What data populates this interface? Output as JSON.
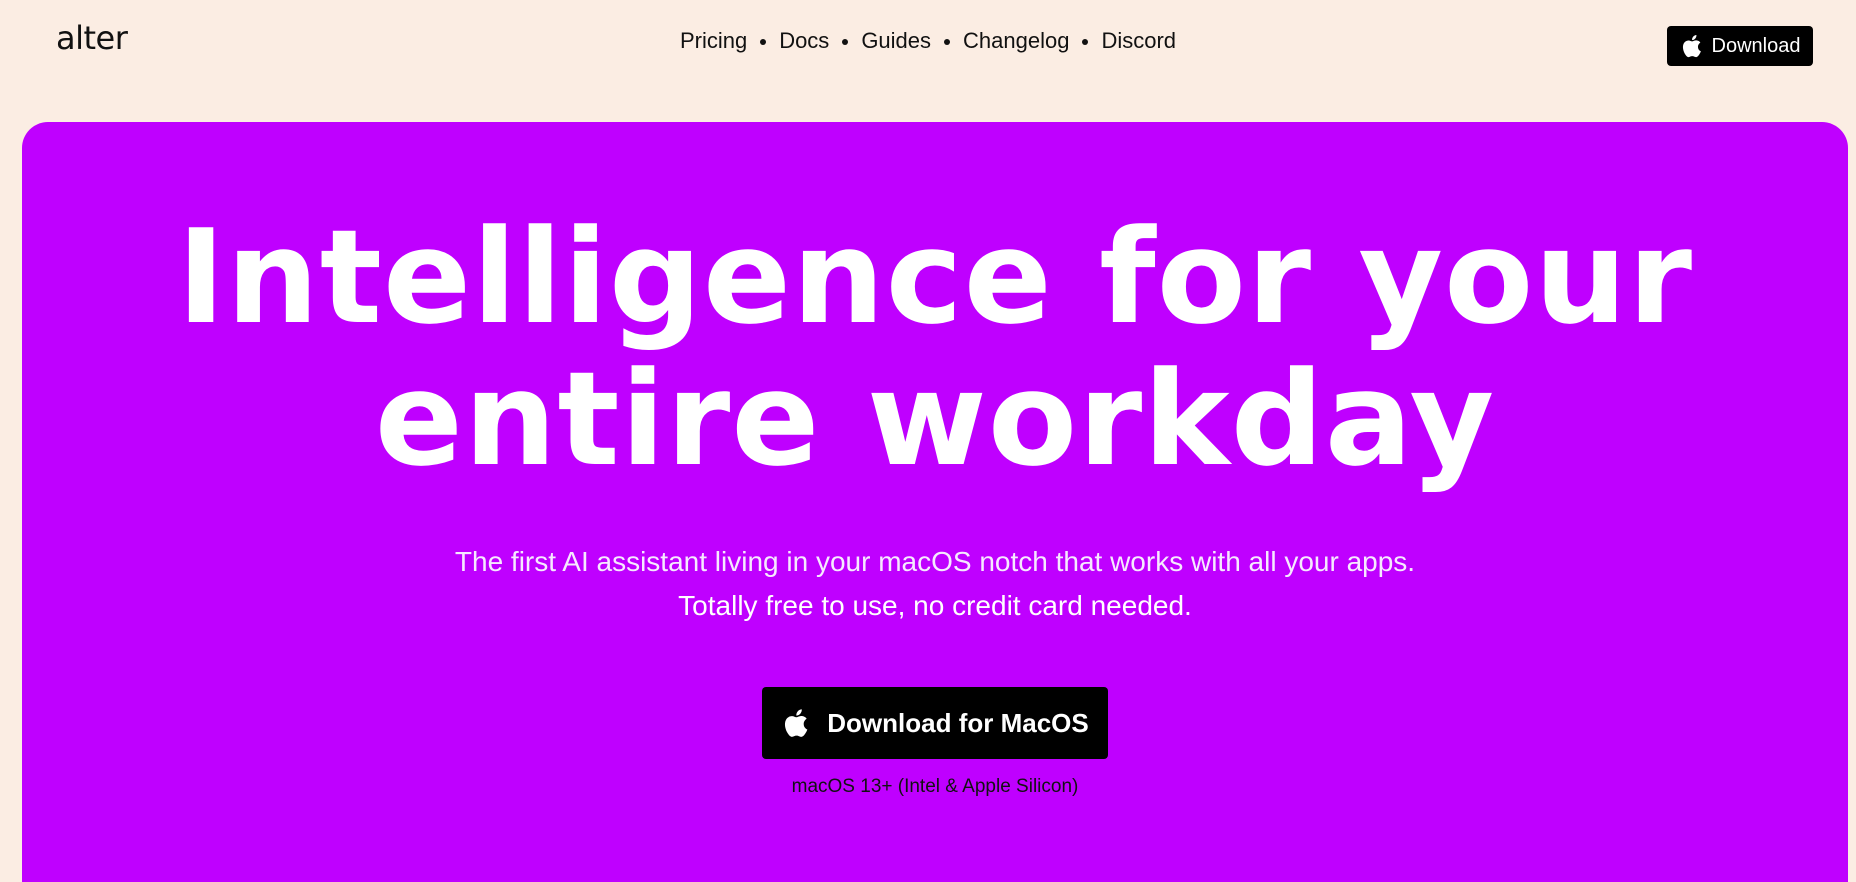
{
  "header": {
    "logo": "alter",
    "nav": [
      "Pricing",
      "Docs",
      "Guides",
      "Changelog",
      "Discord"
    ],
    "download_label": "Download"
  },
  "hero": {
    "headline_line1": "Intelligence for your",
    "headline_line2": "entire workday",
    "subtitle": "The first AI assistant living in your macOS notch that works with all your apps.",
    "subtitle_strong": "Totally free to use, no credit card needed.",
    "cta_label": "Download for MacOS",
    "requirements": "macOS 13+ (Intel & Apple Silicon)"
  },
  "colors": {
    "page_background": "#fbede3",
    "hero_background": "#bf00ff",
    "button_background": "#000000",
    "text_dark": "#111111",
    "text_light": "#ffffff"
  },
  "icons": {
    "download_button_icon": "apple-icon",
    "cta_icon": "apple-icon"
  }
}
